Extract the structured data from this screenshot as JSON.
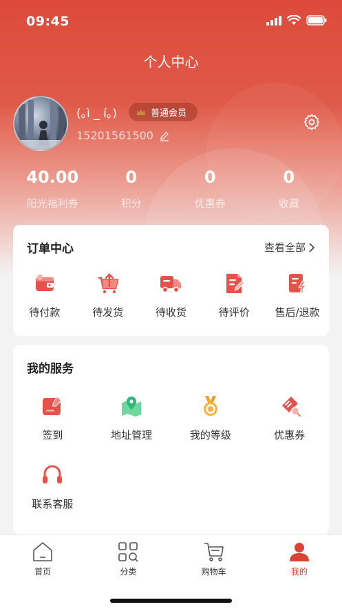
{
  "status_bar": {
    "time": "09:45"
  },
  "page_title": "个人中心",
  "profile": {
    "username": "(｡ì _ í｡)",
    "member_level": "普通会员",
    "phone": "15201561500"
  },
  "stats": [
    {
      "value": "40.00",
      "label": "阳光福利券"
    },
    {
      "value": "0",
      "label": "积分"
    },
    {
      "value": "0",
      "label": "优惠券"
    },
    {
      "value": "0",
      "label": "收藏"
    }
  ],
  "orders": {
    "title": "订单中心",
    "view_all": "查看全部",
    "items": [
      {
        "label": "待付款",
        "icon": "wallet-icon"
      },
      {
        "label": "待发货",
        "icon": "cart-upload-icon"
      },
      {
        "label": "待收货",
        "icon": "truck-icon"
      },
      {
        "label": "待评价",
        "icon": "edit-document-icon"
      },
      {
        "label": "售后/退款",
        "icon": "refund-document-icon"
      }
    ]
  },
  "services": {
    "title": "我的服务",
    "items": [
      {
        "label": "签到",
        "icon": "checkin-icon"
      },
      {
        "label": "地址管理",
        "icon": "map-pin-icon"
      },
      {
        "label": "我的等级",
        "icon": "medal-icon"
      },
      {
        "label": "优惠券",
        "icon": "coupon-icon"
      },
      {
        "label": "联系客服",
        "icon": "headset-icon"
      }
    ]
  },
  "tabbar": [
    {
      "label": "首页",
      "icon": "home-icon",
      "active": false
    },
    {
      "label": "分类",
      "icon": "category-icon",
      "active": false
    },
    {
      "label": "购物车",
      "icon": "cart-icon",
      "active": false
    },
    {
      "label": "我的",
      "icon": "user-icon",
      "active": true
    }
  ],
  "colors": {
    "brand": "#dd4a3a",
    "icon_red": "#e5524a",
    "icon_green": "#41c27f",
    "icon_orange": "#f0a030",
    "tab_active": "#d84536"
  }
}
